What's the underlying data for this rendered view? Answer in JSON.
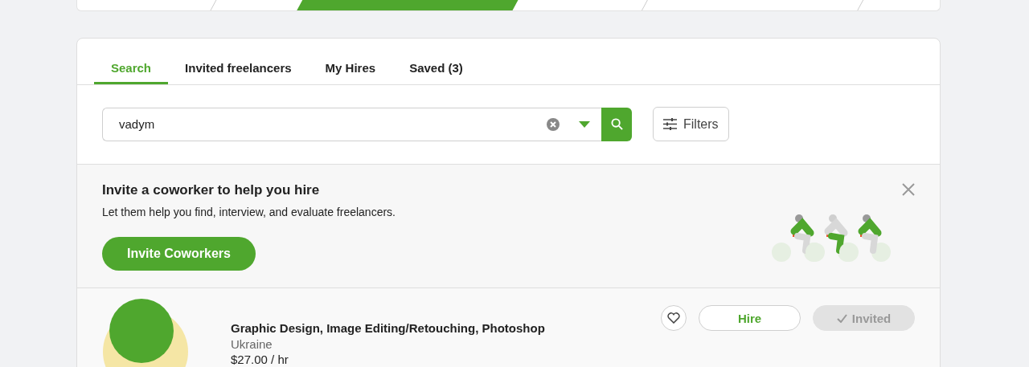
{
  "progress_steps": [
    {
      "selected": false
    },
    {
      "selected": true
    },
    {
      "selected": false
    },
    {
      "selected": false
    }
  ],
  "tabs": [
    {
      "label": "Search",
      "selected": true
    },
    {
      "label": "Invited freelancers",
      "selected": false
    },
    {
      "label": "My Hires",
      "selected": false
    },
    {
      "label": "Saved (3)",
      "selected": false
    }
  ],
  "search": {
    "value": "vadym",
    "filters_label": "Filters"
  },
  "invite_banner": {
    "title": "Invite a coworker to help you hire",
    "text": "Let them help you find, interview, and evaluate freelancers.",
    "button": "Invite Coworkers"
  },
  "freelancers": [
    {
      "skills": "Graphic Design, Image Editing/Retouching, Photoshop",
      "country": "Ukraine",
      "rate": "$27.00 / hr",
      "saved": false,
      "hire_label": "Hire",
      "invite_label": "Invited",
      "invited": true
    }
  ]
}
